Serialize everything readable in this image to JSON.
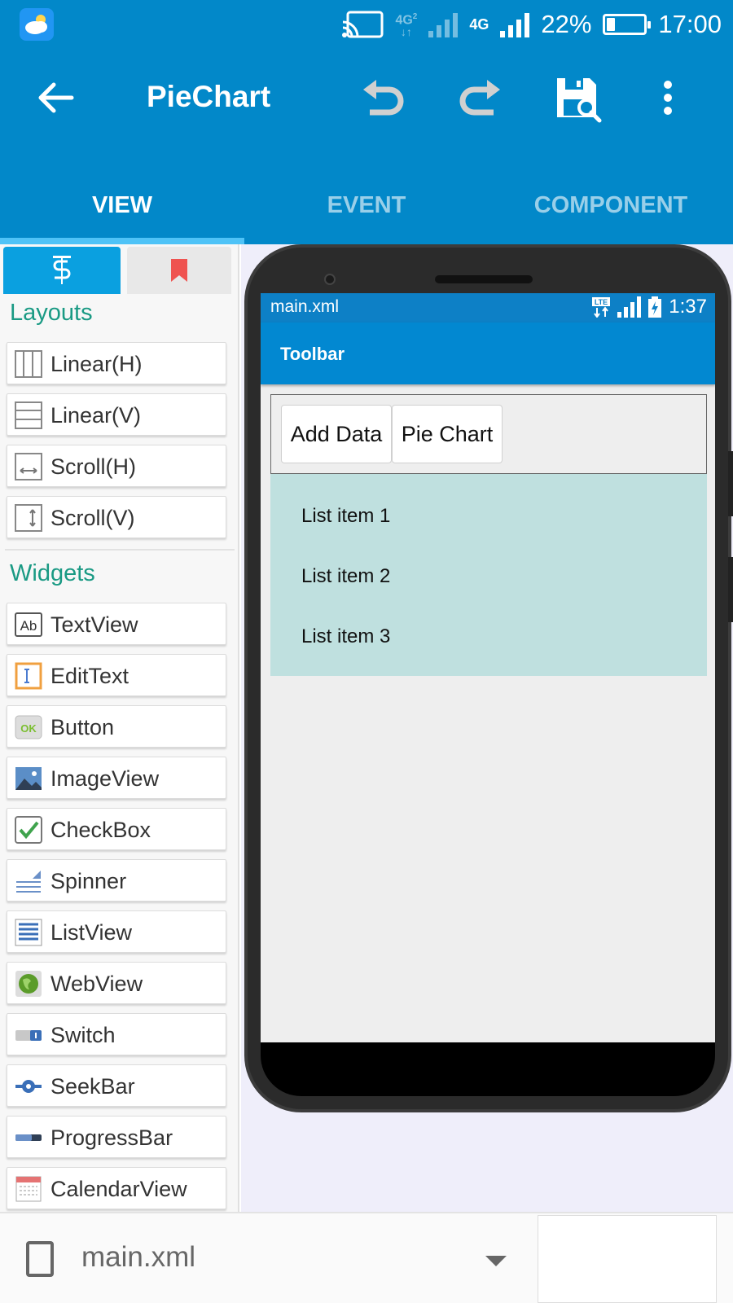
{
  "status_bar": {
    "network_top": "4G",
    "network_sub": "2",
    "network_mid": "4G",
    "battery_percent": "22%",
    "battery_level": 0.22,
    "time": "17:00",
    "icons": [
      "weather-icon",
      "cast-icon",
      "signal-icon",
      "battery-icon"
    ]
  },
  "app_bar": {
    "title": "PieChart",
    "actions": [
      "back-arrow-icon",
      "undo-icon",
      "redo-icon",
      "save-icon",
      "more-vert-icon"
    ]
  },
  "tabs": [
    {
      "label": "VIEW",
      "active": true
    },
    {
      "label": "EVENT",
      "active": false
    },
    {
      "label": "COMPONENT",
      "active": false
    }
  ],
  "palette": {
    "tabs": [
      "widgets-tab-icon",
      "bookmark-icon"
    ],
    "layouts_title": "Layouts",
    "layouts": [
      {
        "label": "Linear(H)",
        "icon": "linear-h-icon"
      },
      {
        "label": "Linear(V)",
        "icon": "linear-v-icon"
      },
      {
        "label": "Scroll(H)",
        "icon": "scroll-h-icon"
      },
      {
        "label": "Scroll(V)",
        "icon": "scroll-v-icon"
      }
    ],
    "widgets_title": "Widgets",
    "widgets": [
      {
        "label": "TextView",
        "icon": "textview-icon"
      },
      {
        "label": "EditText",
        "icon": "edittext-icon"
      },
      {
        "label": "Button",
        "icon": "button-icon",
        "icon_text": "OK"
      },
      {
        "label": "ImageView",
        "icon": "imageview-icon"
      },
      {
        "label": "CheckBox",
        "icon": "checkbox-icon"
      },
      {
        "label": "Spinner",
        "icon": "spinner-icon"
      },
      {
        "label": "ListView",
        "icon": "listview-icon"
      },
      {
        "label": "WebView",
        "icon": "webview-icon"
      },
      {
        "label": "Switch",
        "icon": "switch-icon"
      },
      {
        "label": "SeekBar",
        "icon": "seekbar-icon"
      },
      {
        "label": "ProgressBar",
        "icon": "progressbar-icon"
      },
      {
        "label": "CalendarView",
        "icon": "calendarview-icon"
      }
    ]
  },
  "preview": {
    "status": {
      "filename": "main.xml",
      "time": "1:37",
      "lte": "LTE"
    },
    "toolbar_title": "Toolbar",
    "buttons": [
      "Add Data",
      "Pie Chart"
    ],
    "list_items": [
      "List item 1",
      "List item 2",
      "List item 3"
    ]
  },
  "bottom_bar": {
    "file": "main.xml"
  }
}
